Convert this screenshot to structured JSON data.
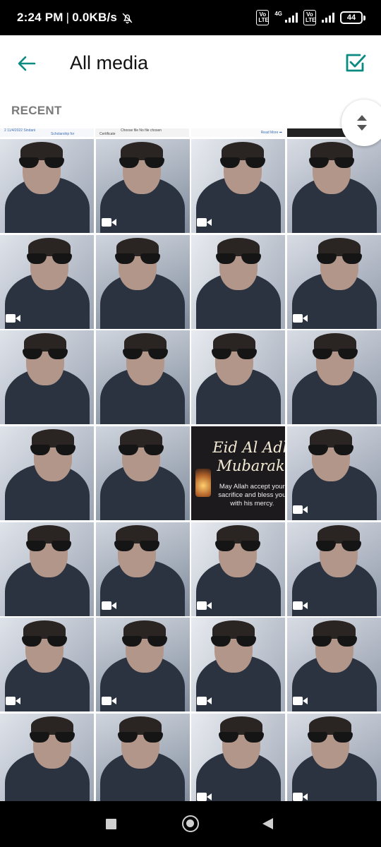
{
  "status_bar": {
    "time": "2:24 PM",
    "separator": "|",
    "network_speed": "0.0KB/s",
    "mute_icon": "bell-off-icon",
    "sim1_badge": "Vo LTE",
    "net_type": "4G",
    "sim2_badge": "Vo LTE",
    "battery_level": "44"
  },
  "app_bar": {
    "back_icon": "arrow-left-icon",
    "title": "All media",
    "select_icon": "checkbox-checked-icon",
    "accent_color": "#0a8a80"
  },
  "section": {
    "label": "RECENT"
  },
  "partial_row_snippets": {
    "a": "2        11/4/2022     Sindani",
    "b": "Scholarship for",
    "c": "Choose file   No file chosen",
    "d": "Certificate",
    "e": "Read More ➡"
  },
  "eid_card": {
    "line1": "Eid Al Adh",
    "line2": "Mubarak!",
    "message": "May Allah accept your sacrifice and bless you with his mercy."
  },
  "tiles": [
    {
      "kind": "photo",
      "video": false
    },
    {
      "kind": "photo",
      "video": true
    },
    {
      "kind": "photo",
      "video": true
    },
    {
      "kind": "photo",
      "video": false
    },
    {
      "kind": "photo",
      "video": true
    },
    {
      "kind": "photo",
      "video": false
    },
    {
      "kind": "photo",
      "video": false
    },
    {
      "kind": "photo",
      "video": true
    },
    {
      "kind": "photo",
      "video": false
    },
    {
      "kind": "photo",
      "video": false
    },
    {
      "kind": "photo",
      "video": false
    },
    {
      "kind": "photo",
      "video": false
    },
    {
      "kind": "photo",
      "video": false
    },
    {
      "kind": "photo",
      "video": false
    },
    {
      "kind": "eid",
      "video": false
    },
    {
      "kind": "photo",
      "video": true
    },
    {
      "kind": "photo",
      "video": false
    },
    {
      "kind": "photo",
      "video": true
    },
    {
      "kind": "photo",
      "video": true
    },
    {
      "kind": "photo",
      "video": true
    },
    {
      "kind": "photo",
      "video": true
    },
    {
      "kind": "photo",
      "video": true
    },
    {
      "kind": "photo",
      "video": true
    },
    {
      "kind": "photo",
      "video": true
    },
    {
      "kind": "photo",
      "video": false
    },
    {
      "kind": "photo",
      "video": false
    },
    {
      "kind": "photo",
      "video": true
    },
    {
      "kind": "photo",
      "video": true
    }
  ],
  "nav_bar": {
    "recents_icon": "square-icon",
    "home_icon": "circle-home-icon",
    "back_icon": "triangle-back-icon"
  }
}
